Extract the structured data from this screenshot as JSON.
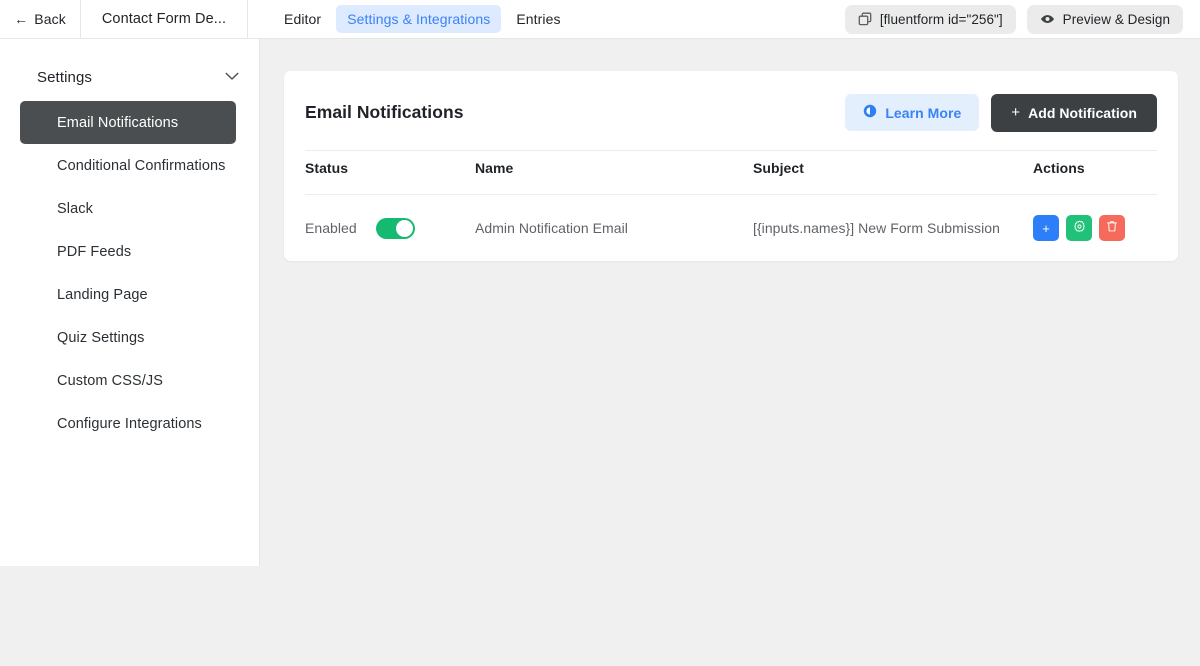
{
  "topbar": {
    "back_label": "Back",
    "back_icon": "arrow-left-icon",
    "form_title": "Contact Form De...",
    "tabs": [
      {
        "label": "Editor",
        "active": false
      },
      {
        "label": "Settings & Integrations",
        "active": true
      },
      {
        "label": "Entries",
        "active": false
      }
    ],
    "shortcode": {
      "label": "[fluentform id=\"256\"]",
      "icon": "copy-icon"
    },
    "preview": {
      "label": "Preview & Design",
      "icon": "eye-icon"
    }
  },
  "sidebar": {
    "section_label": "Settings",
    "section_icon": "chevron-down-icon",
    "items": [
      {
        "label": "Email Notifications",
        "active": true
      },
      {
        "label": "Conditional Confirmations",
        "active": false
      },
      {
        "label": "Slack",
        "active": false
      },
      {
        "label": "PDF Feeds",
        "active": false
      },
      {
        "label": "Landing Page",
        "active": false
      },
      {
        "label": "Quiz Settings",
        "active": false
      },
      {
        "label": "Custom CSS/JS",
        "active": false
      },
      {
        "label": "Configure Integrations",
        "active": false
      }
    ]
  },
  "card": {
    "title": "Email Notifications",
    "learn_more_label": "Learn More",
    "learn_more_icon": "info-circle-icon",
    "add_notification_label": "Add Notification",
    "add_notification_icon": "plus-icon",
    "table": {
      "headers": [
        "Status",
        "Name",
        "Subject",
        "Actions"
      ],
      "rows": [
        {
          "status_text": "Enabled",
          "status_enabled": true,
          "name": "Admin Notification Email",
          "subject": "[{inputs.names}] New Form Submission",
          "actions": [
            {
              "name": "duplicate-notification-button",
              "icon": "plus-icon",
              "color": "#2d7ff9"
            },
            {
              "name": "edit-notification-button",
              "icon": "gear-icon",
              "color": "#21c17a"
            },
            {
              "name": "delete-notification-button",
              "icon": "trash-icon",
              "color": "#f56a5b"
            }
          ]
        }
      ]
    }
  },
  "colors": {
    "accent_blue": "#3b82f6",
    "active_sidebar": "#4a4e50",
    "toggle_on": "#13ba70",
    "page_bg": "#f0f0f0"
  }
}
